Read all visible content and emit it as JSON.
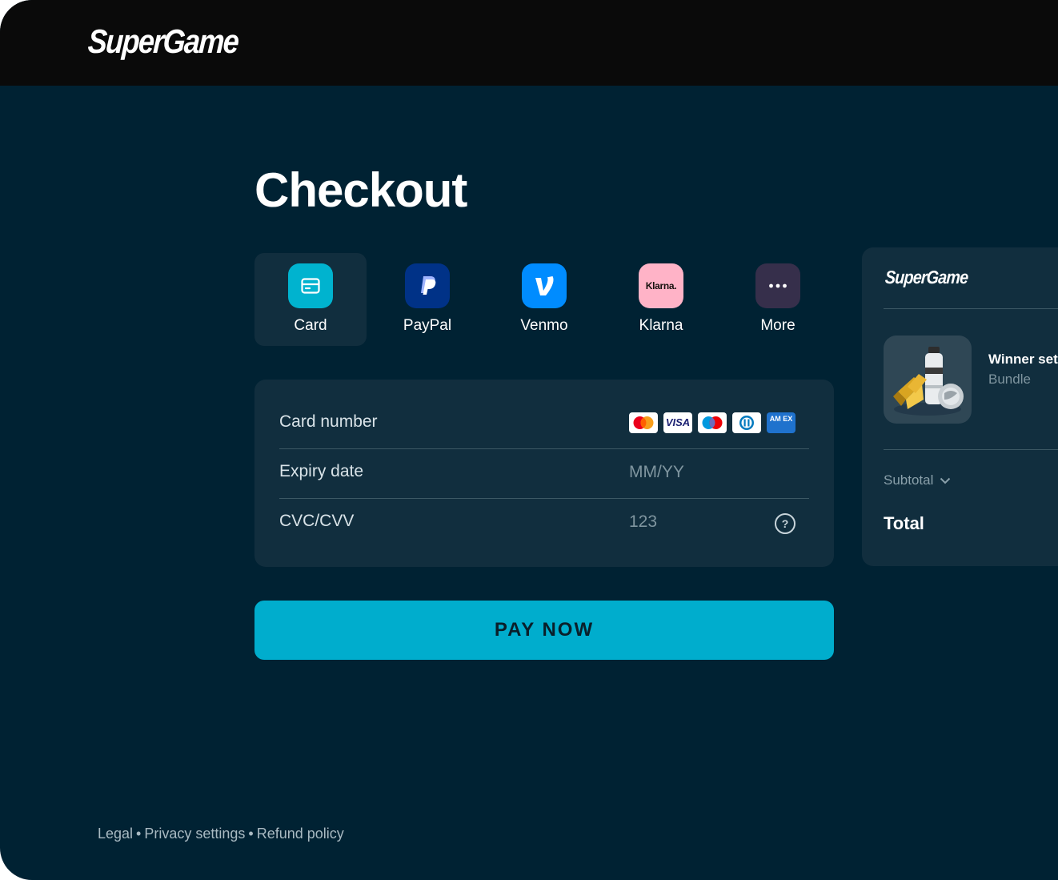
{
  "header": {
    "logo": "SuperGame"
  },
  "page_title": "Checkout",
  "payment_methods": [
    {
      "label": "Card",
      "icon": "card-icon",
      "color": "#00b3cf",
      "selected": true
    },
    {
      "label": "PayPal",
      "icon": "paypal-icon",
      "color": "#003287",
      "selected": false
    },
    {
      "label": "Venmo",
      "icon": "venmo-icon",
      "color": "#008cff",
      "selected": false
    },
    {
      "label": "Klarna",
      "icon": "klarna-icon",
      "color": "#ffb3c7",
      "selected": false
    },
    {
      "label": "More",
      "icon": "more-icon",
      "color": "#362f4b",
      "selected": false
    }
  ],
  "card_form": {
    "card_number_label": "Card number",
    "card_brands": [
      "mastercard-icon",
      "visa-icon",
      "maestro-icon",
      "diners-icon",
      "amex-icon"
    ],
    "visa_text": "VISA",
    "amex_text": "AM EX",
    "expiry_label": "Expiry date",
    "expiry_placeholder": "MM/YY",
    "cvc_label": "CVC/CVV",
    "cvc_placeholder": "123",
    "help_glyph": "?"
  },
  "klarna_text": "Klarna.",
  "pay_button": "PAY NOW",
  "summary": {
    "logo": "SuperGame",
    "product_name": "Winner set",
    "product_type": "Bundle",
    "subtotal_label": "Subtotal",
    "total_label": "Total"
  },
  "footer": {
    "links": [
      "Legal",
      "Privacy settings",
      "Refund policy"
    ],
    "separator": "•"
  },
  "colors": {
    "background": "#002233",
    "panel": "#112e3e",
    "accent": "#00adcd",
    "topbar": "#0a0a0a"
  }
}
